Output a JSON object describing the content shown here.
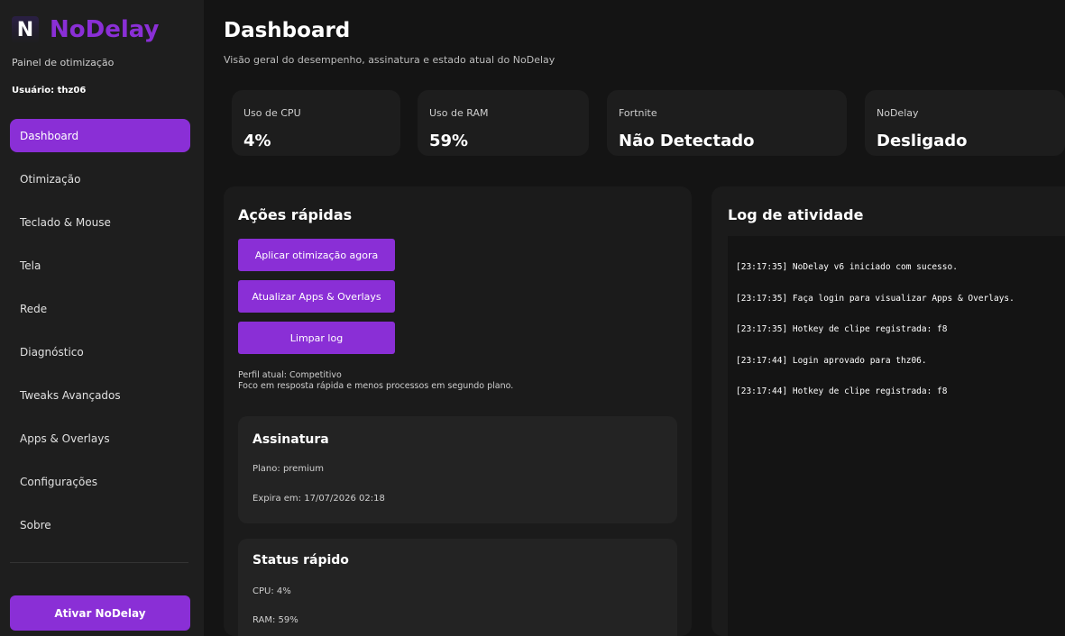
{
  "sidebar": {
    "logo_letter": "N",
    "app_name": "NoDelay",
    "subtitle": "Painel de otimização",
    "user": "Usuário: thz06",
    "items": [
      {
        "label": "Dashboard",
        "active": true
      },
      {
        "label": "Otimização"
      },
      {
        "label": "Teclado & Mouse"
      },
      {
        "label": "Tela"
      },
      {
        "label": "Rede"
      },
      {
        "label": "Diagnóstico"
      },
      {
        "label": "Tweaks Avançados"
      },
      {
        "label": "Apps & Overlays"
      },
      {
        "label": "Configurações"
      },
      {
        "label": "Sobre"
      }
    ],
    "activate_label": "Ativar NoDelay"
  },
  "header": {
    "title": "Dashboard",
    "subtitle": "Visão geral do desempenho, assinatura e estado atual do NoDelay"
  },
  "stats": [
    {
      "label": "Uso de CPU",
      "value": "4%"
    },
    {
      "label": "Uso de RAM",
      "value": "59%"
    },
    {
      "label": "Fortnite",
      "value": "Não Detectado"
    },
    {
      "label": "NoDelay",
      "value": "Desligado"
    }
  ],
  "quick_actions": {
    "title": "Ações rápidas",
    "buttons": [
      "Aplicar otimização agora",
      "Atualizar Apps & Overlays",
      "Limpar log"
    ],
    "profile_line1": "Perfil atual: Competitivo",
    "profile_line2": "Foco em resposta rápida e menos processos em segundo plano."
  },
  "subscription": {
    "title": "Assinatura",
    "plan": "Plano: premium",
    "expires": "Expira em: 17/07/2026 02:18"
  },
  "quick_status": {
    "title": "Status rápido",
    "cpu": "CPU: 4%",
    "ram": "RAM: 59%"
  },
  "log": {
    "title": "Log de atividade",
    "lines": [
      "[23:17:35] NoDelay v6 iniciado com sucesso.",
      "[23:17:35] Faça login para visualizar Apps & Overlays.",
      "[23:17:35] Hotkey de clipe registrada: f8",
      "[23:17:44] Login aprovado para thz06.",
      "[23:17:44] Hotkey de clipe registrada: f8"
    ]
  },
  "colors": {
    "accent": "#8a2fd6",
    "background": "#141414",
    "sidebar": "#1e1e1e",
    "card": "#1d1d1d"
  }
}
